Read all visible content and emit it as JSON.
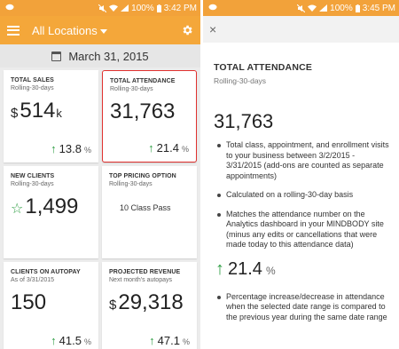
{
  "left": {
    "status": {
      "time": "3:42 PM",
      "battery": "100%"
    },
    "appbar": {
      "location": "All Locations"
    },
    "date": "March 31, 2015",
    "tiles": [
      {
        "title": "TOTAL SALES",
        "sub": "Rolling-30-days",
        "prefix": "$",
        "value": "514",
        "suffix": "k",
        "arrow": "↑",
        "change": "13.8",
        "pct": "%"
      },
      {
        "title": "TOTAL ATTENDANCE",
        "sub": "Rolling-30-days",
        "value": "31,763",
        "arrow": "↑",
        "change": "21.4",
        "pct": "%"
      },
      {
        "title": "NEW CLIENTS",
        "sub": "Rolling-30-days",
        "star": "☆",
        "value": "1,499"
      },
      {
        "title": "TOP PRICING OPTION",
        "sub": "Rolling-30-days",
        "option": "10 Class Pass"
      },
      {
        "title": "CLIENTS ON AUTOPAY",
        "sub": "As of 3/31/2015",
        "value": "150",
        "arrow": "↑",
        "change": "41.5",
        "pct": "%"
      },
      {
        "title": "PROJECTED REVENUE",
        "sub": "Next month's autopays",
        "prefix": "$",
        "value": "29,318",
        "arrow": "↑",
        "change": "47.1",
        "pct": "%"
      }
    ]
  },
  "right": {
    "status": {
      "time": "3:45 PM",
      "battery": "100%"
    },
    "close": "×",
    "title": "TOTAL ATTENDANCE",
    "sub": "Rolling-30-days",
    "value": "31,763",
    "bullets": [
      "Total class, appointment, and enrollment visits to your business between 3/2/2015 - 3/31/2015 (add-ons are counted as separate appointments)",
      "Calculated on a rolling-30-day basis",
      "Matches the attendance number on the Analytics dashboard in your MINDBODY site (minus any edits or cancellations that were made today to this attendance data)"
    ],
    "change": {
      "arrow": "↑",
      "value": "21.4",
      "pct": "%"
    },
    "bullets2": [
      "Percentage increase/decrease in attendance when the selected date range is compared to the previous year during the same date range"
    ]
  },
  "colors": {
    "accent": "#f4a73a",
    "status": "#f2a23a",
    "up": "#2f9e44",
    "highlight": "#e0312f"
  }
}
